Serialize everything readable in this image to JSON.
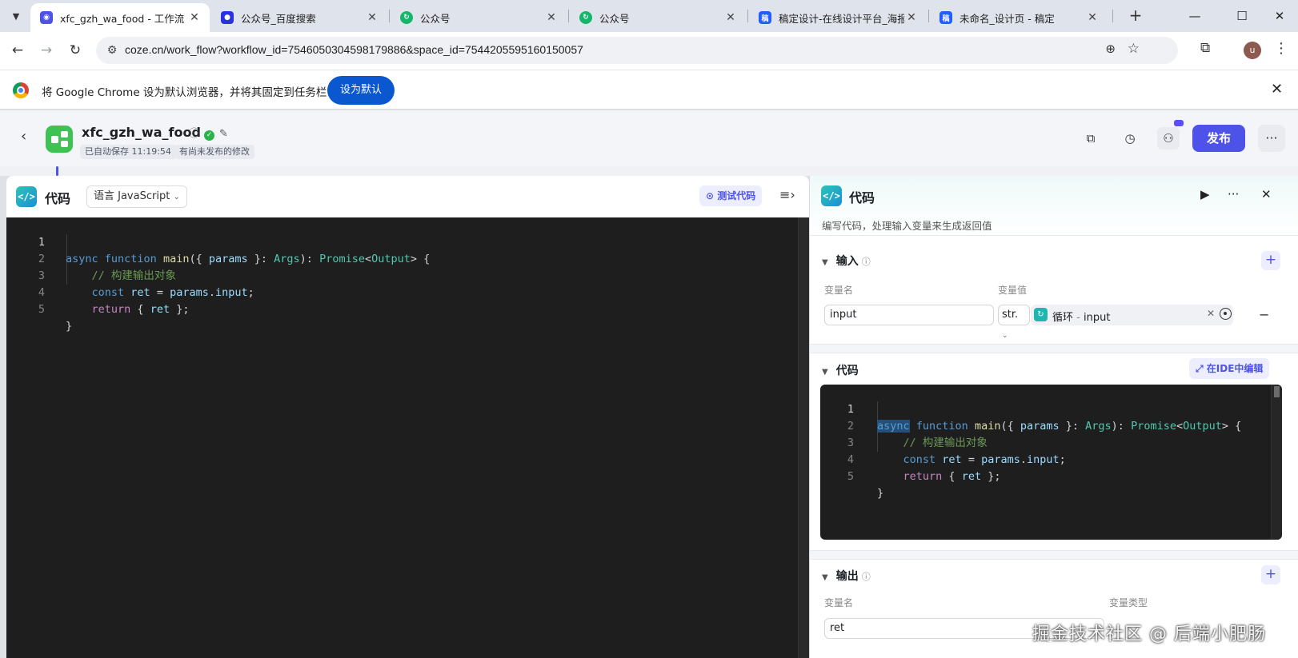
{
  "browser": {
    "tabs": [
      {
        "title": "xfc_gzh_wa_food - 工作流 - 扣",
        "favicon": "coze-icon",
        "color": "#4d53e8",
        "active": true
      },
      {
        "title": "公众号_百度搜索",
        "favicon": "baidu-paw-icon",
        "color": "#2932e1",
        "active": false
      },
      {
        "title": "公众号",
        "favicon": "refresh-swirl-icon",
        "color": "#12b76a",
        "active": false
      },
      {
        "title": "公众号",
        "favicon": "refresh-swirl-icon",
        "color": "#12b76a",
        "active": false
      },
      {
        "title": "稿定设计-在线设计平台_海报",
        "favicon": "gaoding-icon",
        "color": "#1f5fff",
        "active": false
      },
      {
        "title": "未命名_设计页 - 稿定",
        "favicon": "gaoding-icon",
        "color": "#1f5fff",
        "active": false
      }
    ],
    "url": "coze.cn/work_flow?workflow_id=7546050304598179886&space_id=7544205595160150057",
    "avatar_letter": "u",
    "infobar": {
      "message": "将 Google Chrome 设为默认浏览器，并将其固定到任务栏",
      "button": "设为默认"
    }
  },
  "app": {
    "workflow_name": "xfc_gzh_wa_food",
    "autosave": "已自动保存 11:19:54",
    "unpublished": "有尚未发布的修改",
    "publish_label": "发布",
    "accent": "#4d53e8"
  },
  "editor": {
    "title": "代码",
    "language_label": "语言 JavaScript",
    "test_button": "测试代码",
    "code_lines": [
      "async function main({ params }: Args): Promise<Output> {",
      "    // 构建输出对象",
      "    const ret = params.input;",
      "    return { ret };",
      "}"
    ]
  },
  "panel": {
    "title": "代码",
    "description": "编写代码，处理输入变量来生成返回值",
    "input_section": "输入",
    "var_name_header": "变量名",
    "var_value_header": "变量值",
    "input_var_name": "input",
    "input_type": "str.",
    "ref_source": "循环",
    "ref_sep": " - ",
    "ref_var": "input",
    "code_section": "代码",
    "ide_button": "在IDE中编辑",
    "output_section": "输出",
    "out_name_header": "变量名",
    "out_type_header": "变量类型",
    "output_var_name": "ret"
  },
  "watermark": "掘金技术社区 @ 后端小肥肠"
}
